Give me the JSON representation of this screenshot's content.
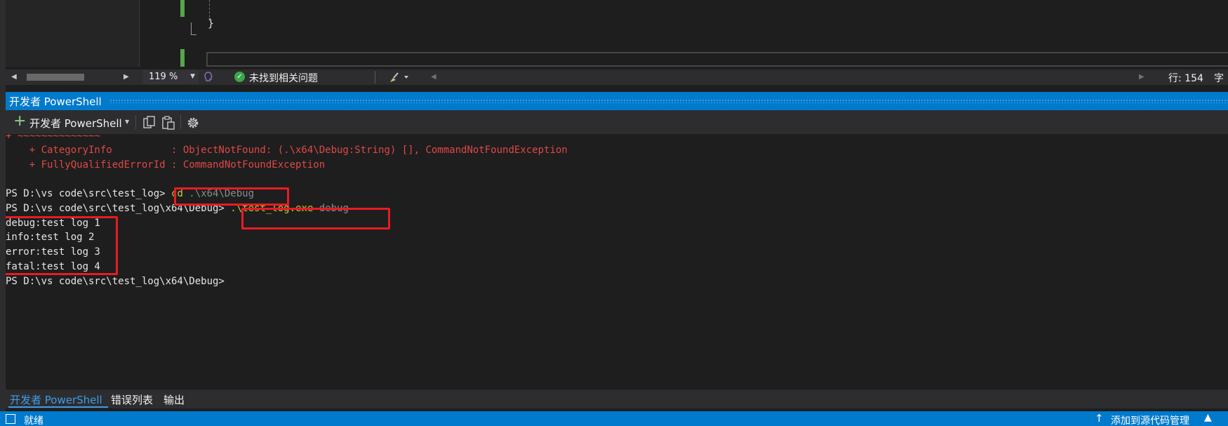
{
  "editor": {
    "brace": "}",
    "zoom": "119 %",
    "issues_text": "未找到相关问题",
    "line_info": "行: 154",
    "char_info": "字"
  },
  "tool_window": {
    "title": "开发者 PowerShell",
    "new_terminal_label": "开发者 PowerShell"
  },
  "terminal": {
    "lines": [
      "+ ~~~~~~~~~~~~~~",
      "    + CategoryInfo          : ObjectNotFound: (.\\x64\\Debug:String) [], CommandNotFoundException",
      "    + FullyQualifiedErrorId : CommandNotFoundException",
      "",
      "PS D:\\vs code\\src\\test_log> ",
      "PS D:\\vs code\\src\\test_log\\x64\\Debug> ",
      "debug:test log 1",
      "info:test log 2",
      "error:test log 3",
      "fatal:test log 4",
      "",
      "PS D:\\vs code\\src\\test_log\\x64\\Debug> "
    ],
    "cmd1_keyword": "cd",
    "cmd1_arg": " .\\x64\\Debug",
    "cmd2_exe": ".\\test_log.exe",
    "cmd2_arg": " debug"
  },
  "bottom_tabs": {
    "items": [
      "开发者 PowerShell",
      "错误列表",
      "输出"
    ],
    "active": 0
  },
  "statusbar": {
    "ready": "就绪",
    "source_control": "添加到源代码管理",
    "source_control_caret": "▲"
  },
  "colors": {
    "accent": "#007acc",
    "error_text": "#e04747",
    "highlight_box": "#e81b23",
    "ok_green": "#3aa84a",
    "active_tab": "#3e9ce6"
  },
  "icons": [
    "chevron-left-icon",
    "chevron-right-icon",
    "chevron-down-icon",
    "intellicode-icon",
    "check-circle-icon",
    "brush-icon",
    "plus-icon",
    "copy-icon",
    "paste-icon",
    "gear-icon",
    "status-window-icon",
    "arrow-up-icon"
  ]
}
